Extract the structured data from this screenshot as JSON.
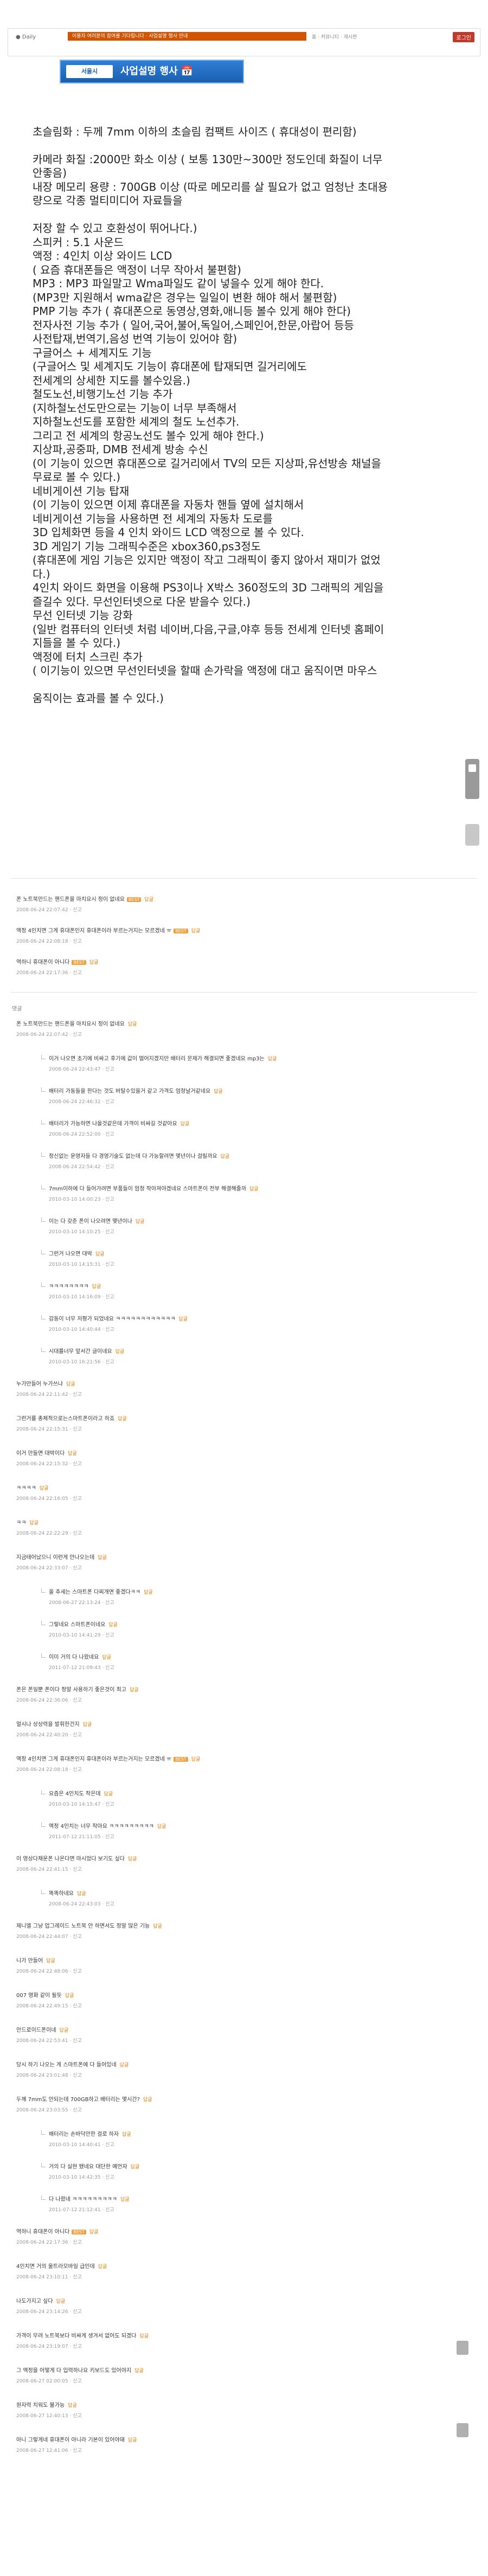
{
  "header": {
    "tab_label": "● Daily",
    "ad_text": "이용자 여러분의 참여를 기다립니다 · 사업설명 행사 안내",
    "login_label": "로그인",
    "nav_text": "홈 · 커뮤니티 · 게시판",
    "banner_logo": "서울시",
    "banner_text": "사업설명 행사 📅"
  },
  "post": {
    "lines": [
      "",
      "초슬림화 : 두께 7mm 이하의 초슬림 컴팩트 사이즈 ( 휴대성이 편리함)",
      "",
      "카메라 화질 :2000만 화소 이상 ( 보통 130만~300만 정도인데 화질이 너무",
      "안좋음)",
      "내장 메모리 용량 : 700GB 이상 (따로 메모리를 살 필요가 없고 엄청난 초대용",
      "량으로 각종 멀티미디어 자료들을",
      "",
      "저장 할 수 있고 호환성이 뛰어나다.)",
      "스피커 : 5.1 사운드",
      "액정 : 4인치 이상 와이드 LCD",
      "( 요즘 휴대폰들은 액정이 너무 작아서 불편함)",
      "MP3 : MP3 파일말고 Wma파일도 같이 넣을수 있게 해야 한다.",
      "(MP3만 지원해서 wma같은 경우는 일일이 변환 해야 해서 불편함)",
      "PMP 기능 추가 ( 휴대폰으로 동영상,영화,애니등 볼수 있게 해야 한다)",
      "전자사전 기능 추가 ( 일어,국어,불어,독일어,스페인어,한문,아랍어 등등",
      "사전탑재,번역기,음성 번역 기능이 있어야 함)",
      "구글어스 + 세계지도 기능",
      "(구글어스 및 세계지도 기능이 휴대폰에 탑재되면 길거리에도",
      "전세계의 상세한 지도를 볼수있음.)",
      "철도노선,비행기노선 기능 추가",
      "(지하철노선도만으로는 기능이 너무 부족해서",
      "지하철노선도를 포함한 세계의 철도 노선추가.",
      "그리고 전 세계의 항공노선도 볼수 있게 해야 한다.)",
      "지상파,공중파, DMB 전세계 방송 수신",
      "(이 기능이 있으면 휴대폰으로 길거리에서 TV의 모든 지상파,유선방송 채널을",
      "무료로 볼 수 있다.)",
      "네비게이션 기능 탑재",
      "(이 기능이 있으면 이제 휴대폰을 자동차 핸들 옆에 설치해서",
      "네비게이션 기능을 사용하면 전 세계의 자동차 도로를",
      "3D 입체화면 등을 4 인치 와이드 LCD 액정으로 볼 수 있다.",
      "3D 게임기 기능 그래픽수준은 xbox360,ps3정도",
      "(휴대폰에 게임 기능은 있지만 액정이 작고 그래픽이 좋지 않아서 재미가 없었",
      "다.)",
      "4인치 와이드 화면을 이용해 PS3이나 X박스 360정도의 3D 그래픽의 게임을",
      "즐길수 있다. 무선인터넷으로 다운 받을수 있다.)",
      "무선 인터넷 기능 강화",
      "(일반 컴퓨터의 인터넷 처럼 네이버,다음,구글,야후 등등 전세계 인터넷 홈페이",
      "지들을 볼 수 있다.)",
      "액정에 터치 스크린 추가",
      "( 이기능이 있으면 무선인터넷을 할때 손가락을 액정에 대고 움직이면 마우스",
      "",
      "움직이는 효과를 볼 수 있다.)"
    ]
  },
  "best_comments": [
    {
      "text": "폰 노트북만드는 핸드폰을 마치요시 정이 없네요",
      "meta": "2008-06-24 22:07:42 · 신고",
      "badge": "BEST"
    },
    {
      "text": "액정 4인치면 그게 휴대폰인지 휴대폰이라 부르는거지는 모르겠네 ㅠ",
      "meta": "2008-06-24 22:08:18 · 신고",
      "badge": "BEST"
    },
    {
      "text": "역하니 휴대폰이 아니다",
      "meta": "2008-06-24 22:17:36 · 신고",
      "badge": "BEST"
    }
  ],
  "comment_section_label": "댓글",
  "comments": [
    {
      "reply": false,
      "text": "폰 노트북만드는 핸드폰을 마치요시 정이 없네요",
      "meta": "2008-06-24 22:07:42 · 신고"
    },
    {
      "reply": true,
      "text": "이거 나오면 초기에 비싸고 후기에 값이 떨어지겠지만 배터리 문제가 해결되면 좋겠네요 mp3는",
      "meta": "2008-06-24 22:43:47 · 신고"
    },
    {
      "reply": true,
      "text": "배터리 가동들을 한다는 것도 버탈수있을거 같고 가격도 엄청날거같네요",
      "meta": "2008-06-24 22:46:32 · 신고"
    },
    {
      "reply": true,
      "text": "배터리가 가능하면 나올것같은데 가격이 비싸길 것같아요",
      "meta": "2008-06-24 22:52:00 · 신고"
    },
    {
      "reply": true,
      "text": "정신없는 운영자들 다 경영기술도 없는데 다 가능할려면 몇년이나 걸릴까요",
      "meta": "2008-06-24 22:54:42 · 신고"
    },
    {
      "reply": true,
      "text": "7mm이하에 다 들어가려면 부품들이 엄청 작아져야겠네요 스마트폰이 전부 해결해줄까",
      "meta": "2010-03-10 14:00:23 · 신고"
    },
    {
      "reply": true,
      "text": "이는 다 갖춘 폰이 나오려면 몇년이나",
      "meta": "2010-03-10 14:10:25 · 신고"
    },
    {
      "reply": true,
      "text": "그런거 나오면 대박",
      "meta": "2010-03-10 14:15:31 · 신고"
    },
    {
      "reply": true,
      "text": "ㅋㅋㅋㅋㅋㅋㅋㅋ",
      "meta": "2010-03-10 14:16:09 · 신고"
    },
    {
      "reply": true,
      "text": "감동이 너무 저평가 되었네요 ㅋㅋㅋㅋㅋㅋㅋㅋㅋㅋㅋㅋ",
      "meta": "2010-03-10 14:40:44 · 신고"
    },
    {
      "reply": true,
      "text": "시대를너무 앞서간 글이네요",
      "meta": "2010-03-10 16:21:56 · 신고"
    },
    {
      "reply": false,
      "text": "누가만들어 누가쓰냐",
      "meta": "2008-06-24 22:11:42 · 신고"
    },
    {
      "reply": false,
      "text": "그런거를 총체적으로는스마트폰이라고 하죠",
      "meta": "2008-06-24 22:15:31 · 신고"
    },
    {
      "reply": false,
      "text": "이거 만들면 대박이다",
      "meta": "2008-06-24 22:15:32 · 신고"
    },
    {
      "reply": false,
      "text": "ㅋㅋㅋㅋ",
      "meta": "2008-06-24 22:16:05 · 신고"
    },
    {
      "reply": false,
      "text": "ㅋㅋ",
      "meta": "2008-06-24 22:22:29 · 신고"
    },
    {
      "reply": false,
      "text": "지금태어났으니 이런게 안나오는데",
      "meta": "2008-06-24 22:33:07 · 신고"
    },
    {
      "reply": true,
      "text": "올 추세는 스마트폰 다찌개면 좋겠다ㅋㅋ",
      "meta": "2008-06-27 22:13:24 · 신고"
    },
    {
      "reply": true,
      "text": "그렇네요 스마트폰이네요",
      "meta": "2010-03-10 14:41:29 · 신고"
    },
    {
      "reply": true,
      "text": "이미 거의 다 나왔네요",
      "meta": "2011-07-12 21:09:43 · 신고"
    },
    {
      "reply": false,
      "text": "폰은 폰일뿐 폰이다 정말 사용하기 좋은것이 최고",
      "meta": "2008-06-24 22:36:06 · 신고"
    },
    {
      "reply": false,
      "text": "얼시나 상상력을 발휘한건지",
      "meta": "2008-06-24 22:40:20 · 신고"
    },
    {
      "reply": false,
      "text": "액정 4인치면 그게 휴대폰인지 휴대폰이라 부르는거지는 모르겠네 ㅠ",
      "meta": "2008-06-24 22:08:18 · 신고",
      "badge": "BEST"
    },
    {
      "reply": true,
      "text": "요즘은 4인치도 작은데",
      "meta": "2010-03-10 14:15:47 · 신고"
    },
    {
      "reply": true,
      "text": "액정 4인치는 너무 작아요 ㅋㅋㅋㅋㅋㅋㅋㅋㅋ",
      "meta": "2011-07-12 21:11:05 · 신고"
    },
    {
      "reply": false,
      "text": "이 영상다채운폰 나온다면 마시었다 보기도 싶다",
      "meta": "2008-06-24 22:41:15 · 신고"
    },
    {
      "reply": true,
      "text": "똑똑하네요",
      "meta": "2008-06-24 22:43:03 · 신고"
    },
    {
      "reply": false,
      "text": "제니엘 그냥 업그레이드 노트북 안 하면서도 정말 많은 기능",
      "meta": "2008-06-24 22:44:07 · 신고"
    },
    {
      "reply": false,
      "text": "니가 만들어",
      "meta": "2008-06-24 22:48:06 · 신고"
    },
    {
      "reply": false,
      "text": "007 영화 같이 될듯",
      "meta": "2008-06-24 22:49:15 · 신고"
    },
    {
      "reply": false,
      "text": "안드로이드폰이네",
      "meta": "2008-06-24 22:53:41 · 신고"
    },
    {
      "reply": false,
      "text": "당시 하기 나오는 게 스마트폰에 다 들어있네",
      "meta": "2008-06-24 23:01:48 · 신고"
    },
    {
      "reply": false,
      "text": "두께 7mm도 안되는데 700GB하고 배터리는 몇시간?",
      "meta": "2008-06-24 23:03:55 · 신고"
    },
    {
      "reply": true,
      "text": "배터리는 손바닥만한 걸로 하자",
      "meta": "2010-03-10 14:40:41 · 신고"
    },
    {
      "reply": true,
      "text": "거의 다 실현 됐네요 대단한 예언자",
      "meta": "2010-03-10 14:42:35 · 신고"
    },
    {
      "reply": true,
      "text": "다 나왔네 ㅋㅋㅋㅋㅋㅋㅋㅋㅋ",
      "meta": "2011-07-12 21:12:41 · 신고"
    },
    {
      "reply": false,
      "text": "역하니 휴대폰이 아니다",
      "meta": "2008-06-24 22:17:36 · 신고",
      "badge": "BEST"
    },
    {
      "reply": false,
      "text": "4인치면 거의 울트라모바일 급인데",
      "meta": "2008-06-24 23:10:11 · 신고"
    },
    {
      "reply": false,
      "text": "나도가지고 싶다",
      "meta": "2008-06-24 23:14:26 · 신고"
    },
    {
      "reply": false,
      "text": "가격이 무려 노트북보다 비싸게 생겨서 없어도 되겠다",
      "meta": "2008-06-24 23:19:07 · 신고"
    },
    {
      "reply": false,
      "text": "그 액정을 어떻게 다 입력하나요 키보드도 있어야지",
      "meta": "2008-06-27 02:00:05 · 신고"
    },
    {
      "reply": false,
      "text": "원자력 치워도 불가능",
      "meta": "2008-06-27 12:40:13 · 신고"
    },
    {
      "reply": false,
      "text": "아니 그렇게네 휴대폰이 아니라 기본이 있어야돼",
      "meta": "2008-06-27 12:41:06 · 신고"
    }
  ],
  "comment_actions": {
    "reply": "답글",
    "report": "신고"
  }
}
